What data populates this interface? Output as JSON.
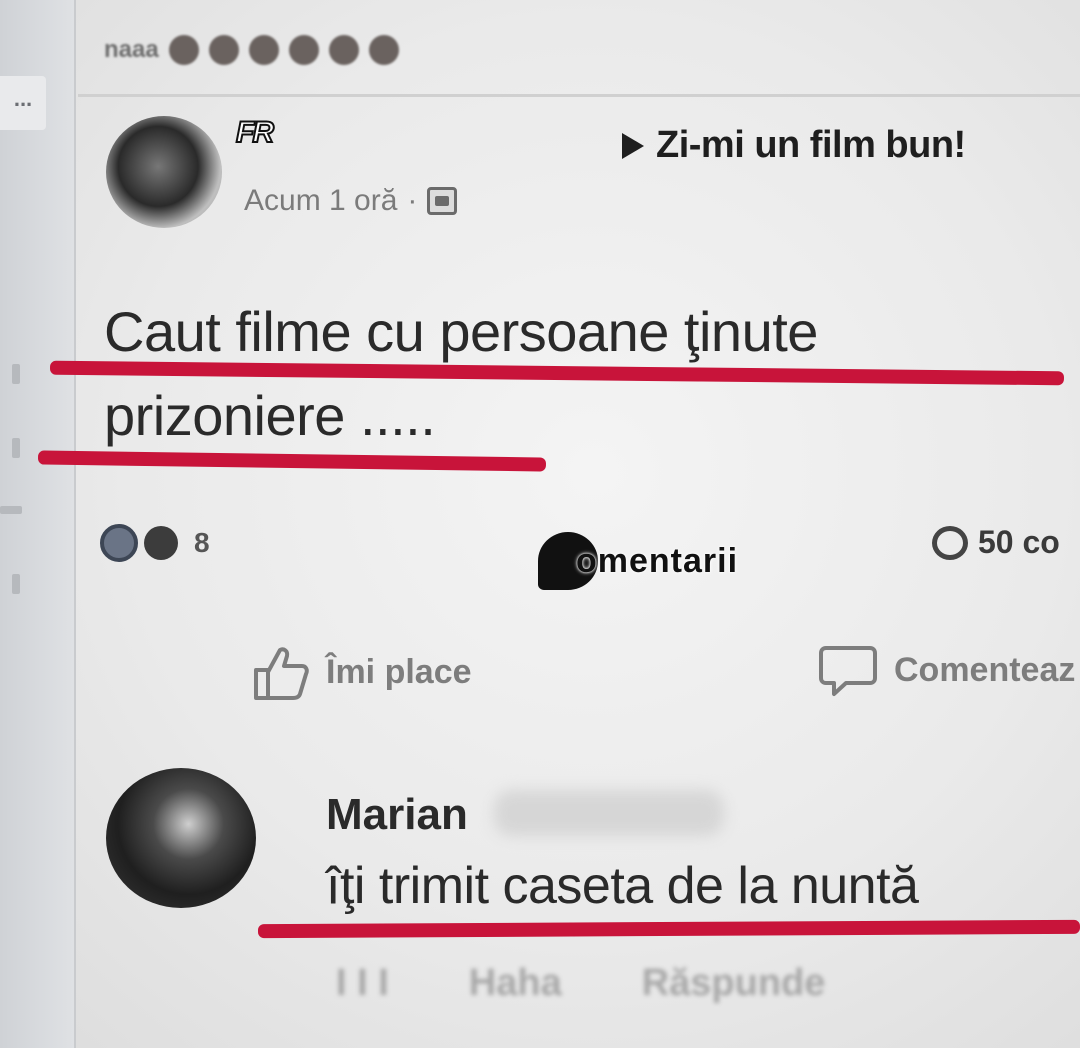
{
  "top": {
    "blurred_name": "naaa"
  },
  "sidebar": {
    "dots": "..."
  },
  "post": {
    "author_mark": "FR",
    "group_name": "Zi-mi un film bun!",
    "time": "Acum 1 oră",
    "separator": "·",
    "text_line1": "Caut filme cu persoane ţinute",
    "text_line2": "prizoniere .....",
    "reaction_count": "8",
    "comments_count": "50 co",
    "like_label": "Îmi place",
    "comment_label": "Comenteaz"
  },
  "watermark": {
    "text": "omentarii"
  },
  "comment": {
    "author_first_name": "Marian",
    "text": "îţi trimit caseta de la nuntă",
    "actions": [
      "I I I",
      "Haha",
      "Răspunde"
    ]
  },
  "colors": {
    "underline": "#c8143a",
    "background": "#ececec",
    "text": "#2a2a2a"
  }
}
